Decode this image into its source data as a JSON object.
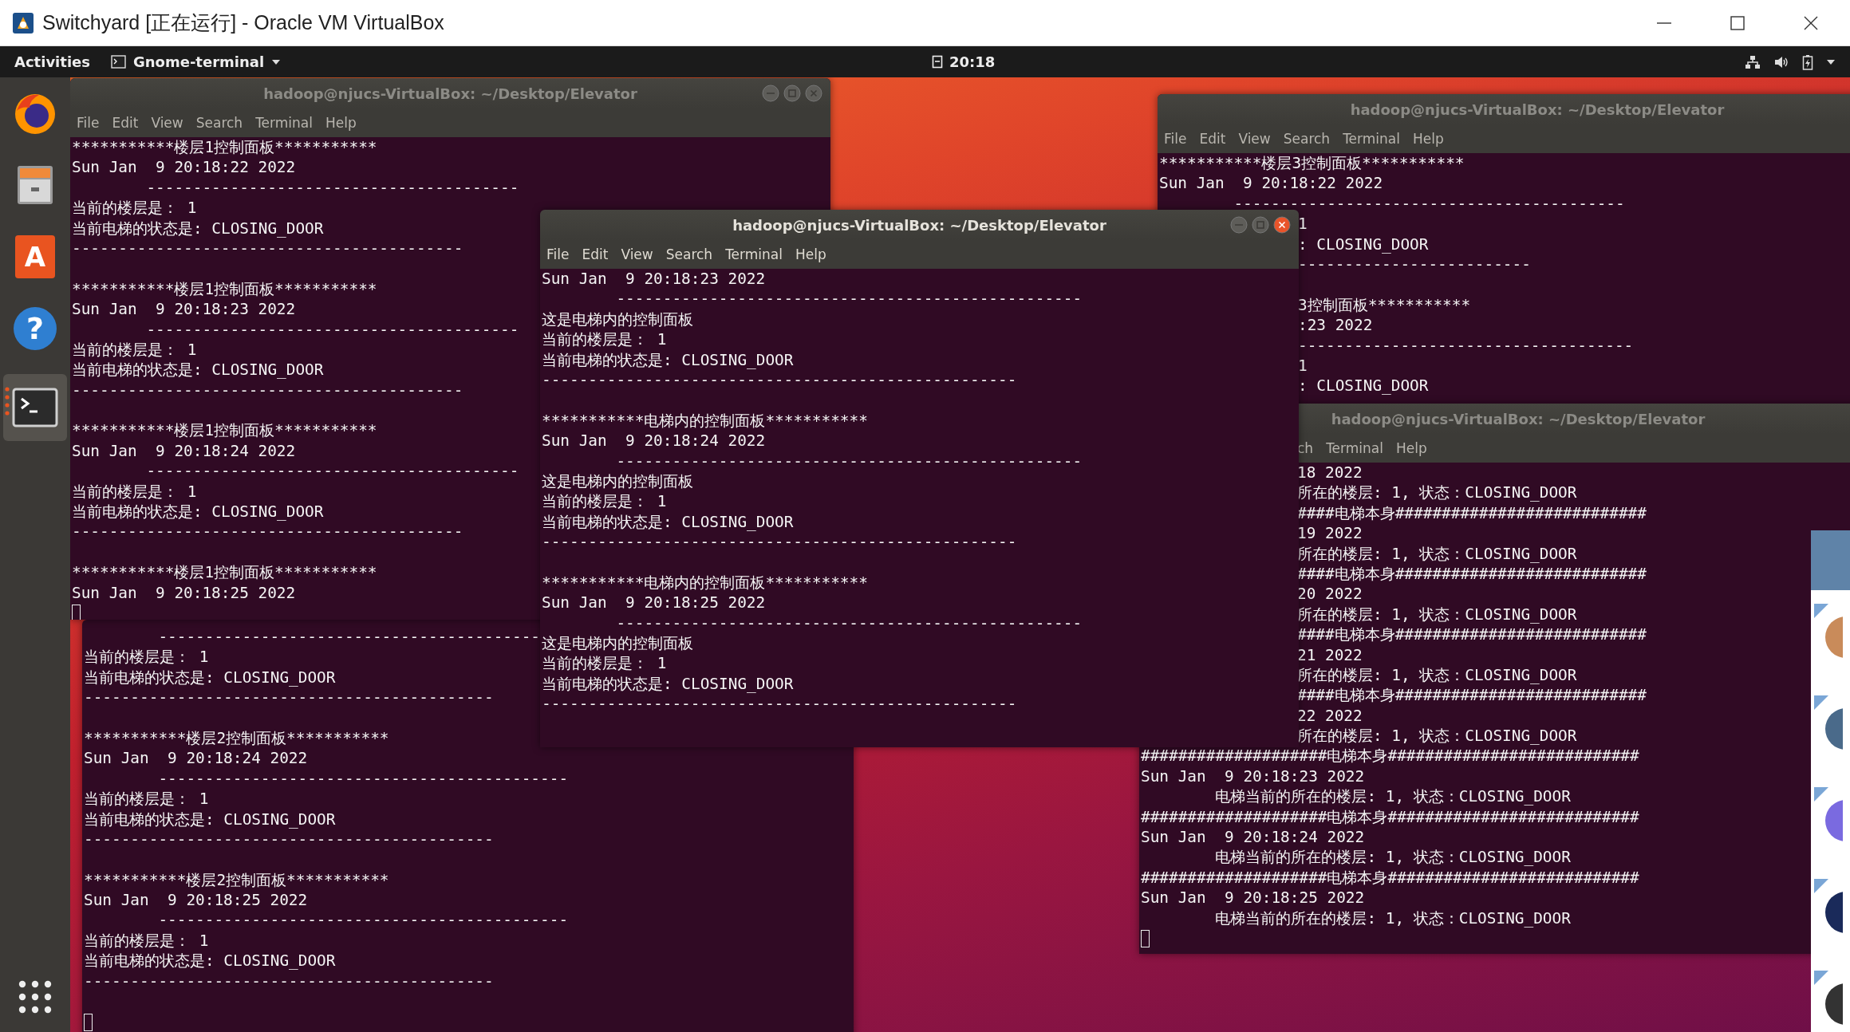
{
  "host_window": {
    "title": "Switchyard [正在运行] - Oracle VM VirtualBox"
  },
  "top_bar": {
    "activities": "Activities",
    "app_menu": "Gnome-terminal",
    "clock": "20:18"
  },
  "dock": [
    {
      "kind": "browser",
      "selected": false
    },
    {
      "kind": "files",
      "selected": false
    },
    {
      "kind": "software",
      "glyph": "A",
      "selected": false
    },
    {
      "kind": "help",
      "glyph": "?",
      "selected": false
    },
    {
      "kind": "terminal",
      "selected": true
    }
  ],
  "windows": [
    {
      "title": "hadoop@njucs-VirtualBox: ~/Desktop/Elevator",
      "focused": false,
      "buttons_shown": true,
      "menu": [
        "File",
        "Edit",
        "View",
        "Search",
        "Terminal",
        "Help"
      ],
      "menu_clipped": false,
      "lines": [
        {
          "kind": "text",
          "text": "***********楼层1控制面板***********"
        },
        {
          "kind": "text",
          "text": "Sun Jan  9 20:18:22 2022"
        },
        {
          "kind": "text",
          "text": "        ----------------------------------------"
        },
        {
          "kind": "text",
          "text": "当前的楼层是： 1"
        },
        {
          "kind": "text",
          "text": "当前电梯的状态是: CLOSING_DOOR"
        },
        {
          "kind": "text",
          "text": "------------------------------------------"
        },
        {
          "kind": "blank"
        },
        {
          "kind": "text",
          "text": "***********楼层1控制面板***********"
        },
        {
          "kind": "text",
          "text": "Sun Jan  9 20:18:23 2022"
        },
        {
          "kind": "text",
          "text": "        ----------------------------------------"
        },
        {
          "kind": "text",
          "text": "当前的楼层是： 1"
        },
        {
          "kind": "text",
          "text": "当前电梯的状态是: CLOSING_DOOR"
        },
        {
          "kind": "text",
          "text": "------------------------------------------"
        },
        {
          "kind": "blank"
        },
        {
          "kind": "text",
          "text": "***********楼层1控制面板***********"
        },
        {
          "kind": "text",
          "text": "Sun Jan  9 20:18:24 2022"
        },
        {
          "kind": "text",
          "text": "        ----------------------------------------"
        },
        {
          "kind": "text",
          "text": "当前的楼层是： 1"
        },
        {
          "kind": "text",
          "text": "当前电梯的状态是: CLOSING_DOOR"
        },
        {
          "kind": "text",
          "text": "------------------------------------------"
        },
        {
          "kind": "blank"
        },
        {
          "kind": "text",
          "text": "***********楼层1控制面板***********"
        },
        {
          "kind": "text",
          "text": "Sun Jan  9 20:18:25 2022"
        },
        {
          "kind": "cursor"
        }
      ]
    },
    {
      "title": "hadoop@njucs-VirtualBox: ~/Desktop/Elevator",
      "focused": false,
      "buttons_shown": false,
      "menu": [
        "File",
        "Edit",
        "View",
        "Search",
        "Terminal",
        "Help"
      ],
      "menu_clipped": false,
      "lines": [
        {
          "kind": "text",
          "text": "***********楼层3控制面板***********"
        },
        {
          "kind": "text",
          "text": "Sun Jan  9 20:18:22 2022"
        },
        {
          "kind": "text",
          "text": "        ------------------------------------------"
        },
        {
          "kind": "partial",
          "text": "1"
        },
        {
          "kind": "partial",
          "text": ": CLOSING_DOOR"
        },
        {
          "kind": "partial",
          "text": "-------------------------"
        },
        {
          "kind": "blank"
        },
        {
          "kind": "partial",
          "text": "3控制面板***********"
        },
        {
          "kind": "partial",
          "text": ":23 2022"
        },
        {
          "kind": "partial",
          "text": "------------------------------------"
        },
        {
          "kind": "partial",
          "text": "1"
        },
        {
          "kind": "partial",
          "text": ": CLOSING_DOOR"
        }
      ]
    },
    {
      "title": "hadoop@njucs-VirtualBox: ~/Desktop/Elevator",
      "focused": true,
      "buttons_shown": true,
      "menu": [
        "File",
        "Edit",
        "View",
        "Search",
        "Terminal",
        "Help"
      ],
      "menu_clipped": false,
      "lines": [
        {
          "kind": "text",
          "text": "Sun Jan  9 20:18:23 2022"
        },
        {
          "kind": "text",
          "text": "        --------------------------------------------------"
        },
        {
          "kind": "text",
          "text": "这是电梯内的控制面板"
        },
        {
          "kind": "text",
          "text": "当前的楼层是： 1"
        },
        {
          "kind": "text",
          "text": "当前电梯的状态是: CLOSING_DOOR"
        },
        {
          "kind": "text",
          "text": "---------------------------------------------------"
        },
        {
          "kind": "blank"
        },
        {
          "kind": "text",
          "text": "***********电梯内的控制面板***********"
        },
        {
          "kind": "text",
          "text": "Sun Jan  9 20:18:24 2022"
        },
        {
          "kind": "text",
          "text": "        --------------------------------------------------"
        },
        {
          "kind": "text",
          "text": "这是电梯内的控制面板"
        },
        {
          "kind": "text",
          "text": "当前的楼层是： 1"
        },
        {
          "kind": "text",
          "text": "当前电梯的状态是: CLOSING_DOOR"
        },
        {
          "kind": "text",
          "text": "---------------------------------------------------"
        },
        {
          "kind": "blank"
        },
        {
          "kind": "text",
          "text": "***********电梯内的控制面板***********"
        },
        {
          "kind": "text",
          "text": "Sun Jan  9 20:18:25 2022"
        },
        {
          "kind": "text",
          "text": "        --------------------------------------------------"
        },
        {
          "kind": "text",
          "text": "这是电梯内的控制面板"
        },
        {
          "kind": "text",
          "text": "当前的楼层是： 1"
        },
        {
          "kind": "text",
          "text": "当前电梯的状态是: CLOSING_DOOR"
        },
        {
          "kind": "text",
          "text": "---------------------------------------------------"
        }
      ]
    },
    {
      "title": "hadoop@njucs-VirtualBox: ~/Desktop/Elevator",
      "focused": false,
      "buttons_shown": false,
      "menu": [
        "ch",
        "Terminal",
        "Help"
      ],
      "menu_clipped": true,
      "lines": [
        {
          "kind": "partial",
          "text": "18 2022"
        },
        {
          "kind": "partial",
          "text": "所在的楼层: 1, 状态：CLOSING_DOOR"
        },
        {
          "kind": "partial",
          "text": "####电梯本身###########################"
        },
        {
          "kind": "partial",
          "text": "19 2022"
        },
        {
          "kind": "partial",
          "text": "所在的楼层: 1, 状态：CLOSING_DOOR"
        },
        {
          "kind": "partial",
          "text": "####电梯本身###########################"
        },
        {
          "kind": "partial",
          "text": "20 2022"
        },
        {
          "kind": "partial",
          "text": "所在的楼层: 1, 状态：CLOSING_DOOR"
        },
        {
          "kind": "partial",
          "text": "####电梯本身###########################"
        },
        {
          "kind": "partial",
          "text": "21 2022"
        },
        {
          "kind": "partial",
          "text": "所在的楼层: 1, 状态：CLOSING_DOOR"
        },
        {
          "kind": "partial",
          "text": "####电梯本身###########################"
        },
        {
          "kind": "partial",
          "text": "22 2022"
        },
        {
          "kind": "partial",
          "text": "所在的楼层: 1, 状态：CLOSING_DOOR"
        },
        {
          "kind": "text",
          "text": "####################电梯本身###########################"
        },
        {
          "kind": "text",
          "text": "Sun Jan  9 20:18:23 2022"
        },
        {
          "kind": "text",
          "text": "        电梯当前的所在的楼层: 1, 状态：CLOSING_DOOR"
        },
        {
          "kind": "text",
          "text": "####################电梯本身###########################"
        },
        {
          "kind": "text",
          "text": "Sun Jan  9 20:18:24 2022"
        },
        {
          "kind": "text",
          "text": "        电梯当前的所在的楼层: 1, 状态：CLOSING_DOOR"
        },
        {
          "kind": "text",
          "text": "####################电梯本身###########################"
        },
        {
          "kind": "text",
          "text": "Sun Jan  9 20:18:25 2022"
        },
        {
          "kind": "text",
          "text": "        电梯当前的所在的楼层: 1, 状态：CLOSING_DOOR"
        },
        {
          "kind": "cursor"
        }
      ]
    },
    {
      "lines": [
        {
          "kind": "text",
          "text": "        -----------------------------------------"
        },
        {
          "kind": "text",
          "text": "当前的楼层是： 1"
        },
        {
          "kind": "text",
          "text": "当前电梯的状态是: CLOSING_DOOR"
        },
        {
          "kind": "text",
          "text": "--------------------------------------------"
        },
        {
          "kind": "blank"
        },
        {
          "kind": "text",
          "text": "***********楼层2控制面板***********"
        },
        {
          "kind": "text",
          "text": "Sun Jan  9 20:18:24 2022"
        },
        {
          "kind": "text",
          "text": "        --------------------------------------------"
        },
        {
          "kind": "text",
          "text": "当前的楼层是： 1"
        },
        {
          "kind": "text",
          "text": "当前电梯的状态是: CLOSING_DOOR"
        },
        {
          "kind": "text",
          "text": "--------------------------------------------"
        },
        {
          "kind": "blank"
        },
        {
          "kind": "text",
          "text": "***********楼层2控制面板***********"
        },
        {
          "kind": "text",
          "text": "Sun Jan  9 20:18:25 2022"
        },
        {
          "kind": "text",
          "text": "        --------------------------------------------"
        },
        {
          "kind": "text",
          "text": "当前的楼层是： 1"
        },
        {
          "kind": "text",
          "text": "当前电梯的状态是: CLOSING_DOOR"
        },
        {
          "kind": "text",
          "text": "--------------------------------------------"
        },
        {
          "kind": "blank"
        },
        {
          "kind": "cursor"
        }
      ]
    }
  ]
}
